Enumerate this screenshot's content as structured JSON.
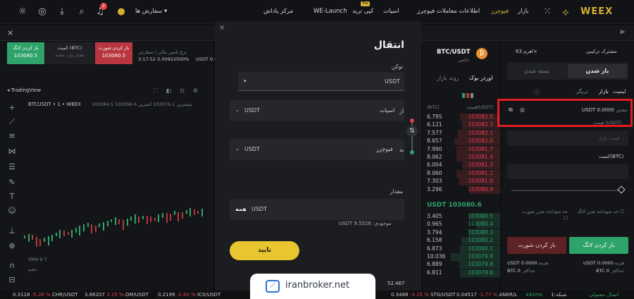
{
  "nav": {
    "logo": "WEEX",
    "items": [
      "بازار",
      "فیوچرز",
      "اطلاعات معاملات فیوچرز",
      "اسپات",
      "کپی ترید",
      "WE-Launch",
      "مرکز پاداش"
    ],
    "pro_badge": "Pro",
    "orders": "سفارش ها",
    "notif_count": "2",
    "accent": "#d4b033"
  },
  "left": {
    "card_long": {
      "title": "باز کردن لانگ",
      "value": "103080.5"
    },
    "card_mid": {
      "title": "کمیت (BTC)",
      "sub": "مقدار وارد نشده"
    },
    "card_short": {
      "title": "باز کردن شورت",
      "value": "103080.5"
    },
    "info_line1": "نرخ تامین مالی / سفارش",
    "info_line2": "3:17:52 0.00922500%",
    "info_pair": "USDT 0.00",
    "tradingview": "TradingView",
    "symbol": "BTCUSDT • 1 • WEEX",
    "ohlc": "103084.5 بیشترین  103076.1 کمترین  103096.6",
    "sma": "SMA 9  7",
    "vol": "حجم"
  },
  "modal": {
    "title": "انتقال",
    "coin_label": "توکن",
    "coin_value": "USDT",
    "from_label": "از",
    "from_value": "اسپات",
    "from_coin": "USDT",
    "to_label": "به",
    "to_value": "فیوچرز",
    "to_coin": "USDT",
    "amount_label": "مقدار",
    "amount_unit": "USDT",
    "amount_all": "همه",
    "available": "USDT 9.5526 :موجودی",
    "confirm": "تایید",
    "close": "×"
  },
  "orderbook": {
    "pair": "BTC/USDT",
    "sub": "دائمی",
    "tab_book": "اوردر بوک",
    "tab_trades": "روند بازار",
    "col_price": "قیمت(USDT)",
    "col_qty": "(BTC)",
    "asks": [
      [
        "103082.5",
        "6.795"
      ],
      [
        "103082.3",
        "6.121"
      ],
      [
        "103082.1",
        "7.577"
      ],
      [
        "103082.0",
        "8.657"
      ],
      [
        "103081.7",
        "7.990"
      ],
      [
        "103081.4",
        "8.062"
      ],
      [
        "103081.3",
        "6.004"
      ],
      [
        "103081.2",
        "8.060"
      ],
      [
        "103081.0",
        "7.303"
      ],
      [
        "103080.9",
        "3.296"
      ]
    ],
    "last_price": "USDT 103080.6",
    "bids": [
      [
        "103080.5",
        "3.405"
      ],
      [
        "103080.4",
        "0.965"
      ],
      [
        "103080.3",
        "3.794"
      ],
      [
        "103080.2",
        "6.158"
      ],
      [
        "103080.1",
        "6.873"
      ],
      [
        "103079.9",
        "10.036"
      ],
      [
        "103079.8",
        "6.889"
      ],
      [
        "103079.6",
        "6.811"
      ]
    ],
    "extra_qty": "52.467"
  },
  "trade": {
    "mode": "مشترک ترکیبی",
    "leverage": "اهرم 63×",
    "tab_open": "باز شدن",
    "tab_close": "بسته شدن",
    "type_limit": "لیمیت",
    "type_market": "بازار",
    "type_trigger": "تریگر",
    "available": "USDT 0.0000",
    "avail_label": "مقدور",
    "price_label": "قیمت (USDT)",
    "price_placeholder": "قیمت بازار",
    "qty_label": "کمیت(BTC)",
    "tp_label": "حد سود/حد ضرر لانگ",
    "sl_label": "حد سود/حد ضرر شورت",
    "btn_long": "باز کردن لانگ",
    "btn_short": "باز کردن شورت",
    "cost_long": "USDT 0.0000",
    "cost_short": "USDT 0.0000",
    "cost_label": "هزینه",
    "max_long": "BTC 0",
    "max_short": "BTC 0",
    "max_label": "حداکثر"
  },
  "ticker": {
    "items": [
      {
        "sym": "CHR/USDT",
        "price": "0.3118",
        "chg": "-5.28 %",
        "dir": "down"
      },
      {
        "sym": "OM/USDT",
        "price": "3.86207",
        "chg": "3.15 %",
        "dir": "down"
      },
      {
        "sym": "ICX/USDT",
        "price": "0.2199",
        "chg": "-2.63 %",
        "dir": "down"
      },
      {
        "sym": "STG/USDT",
        "price": "0.3488",
        "chg": "-3.25 %",
        "dir": "down"
      },
      {
        "sym": "ANKR/L",
        "price": "0.04517",
        "chg": "-1.77 %",
        "dir": "down"
      }
    ],
    "latency": "442ms",
    "network": "شبکه-1",
    "status": "اتصال معمولی"
  },
  "watermark": "iranbroker.net"
}
